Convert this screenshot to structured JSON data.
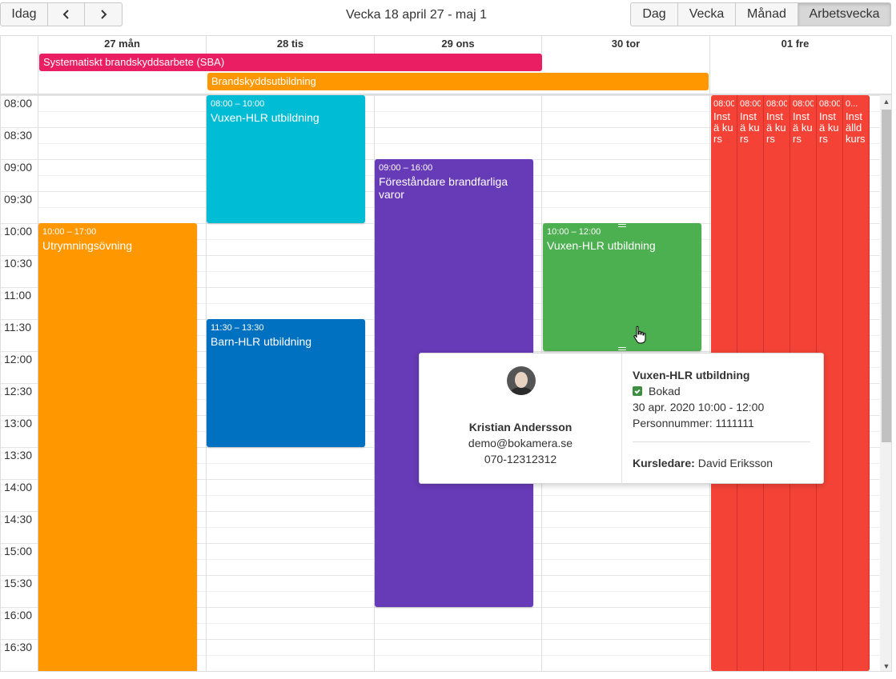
{
  "toolbar": {
    "today_label": "Idag",
    "prev_icon": "chevron-left-icon",
    "next_icon": "chevron-right-icon",
    "title": "Vecka 18 april 27 - maj 1",
    "views": [
      "Dag",
      "Vecka",
      "Månad",
      "Arbetsvecka"
    ],
    "active_view": "Arbetsvecka"
  },
  "days": [
    "27 mån",
    "28 tis",
    "29 ons",
    "30 tor",
    "01 fre"
  ],
  "allday_events": [
    {
      "title": "Systematiskt brandskyddsarbete (SBA)",
      "color": "#e91e63"
    },
    {
      "title": "Brandskyddsutbildning",
      "color": "#ff9800"
    }
  ],
  "times": [
    "08:00",
    "08:30",
    "09:00",
    "09:30",
    "10:00",
    "10:30",
    "11:00",
    "11:30",
    "12:00",
    "12:30",
    "13:00",
    "13:30",
    "14:00",
    "14:30",
    "15:00",
    "15:30",
    "16:00",
    "16:30"
  ],
  "events": [
    {
      "time": "08:00 – 10:00",
      "title": "Vuxen-HLR utbildning",
      "color": "#00bcd4"
    },
    {
      "time": "10:00 – 17:00",
      "title": "Utrymningsövning",
      "color": "#ff9800"
    },
    {
      "time": "09:00 – 16:00",
      "title": "Föreståndare brandfarliga varor",
      "color": "#673ab7"
    },
    {
      "time": "10:00 – 12:00",
      "title": "Vuxen-HLR utbildning",
      "color": "#4caf50"
    },
    {
      "time": "11:30 – 13:30",
      "title": "Barn-HLR utbildning",
      "color": "#0070c0"
    }
  ],
  "friday_events": [
    {
      "time": "08:00",
      "title": "Instä kurs"
    },
    {
      "time": "08:00",
      "title": "Instä kurs"
    },
    {
      "time": "08:00",
      "title": "Instä kurs"
    },
    {
      "time": "08:00",
      "title": "Instä kurs"
    },
    {
      "time": "08:00",
      "title": "Instä kurs"
    },
    {
      "time": "0...",
      "title": "Inställd kurs"
    }
  ],
  "friday_color": "#f44336",
  "popover": {
    "name": "Kristian Andersson",
    "email": "demo@bokamera.se",
    "phone": "070-12312312",
    "event_title": "Vuxen-HLR utbildning",
    "status": "Bokad",
    "datetime": "30 apr. 2020 10:00 - 12:00",
    "personnummer": "Personnummer: 1111111",
    "leader_label": "Kursledare:",
    "leader_name": "David Eriksson"
  }
}
